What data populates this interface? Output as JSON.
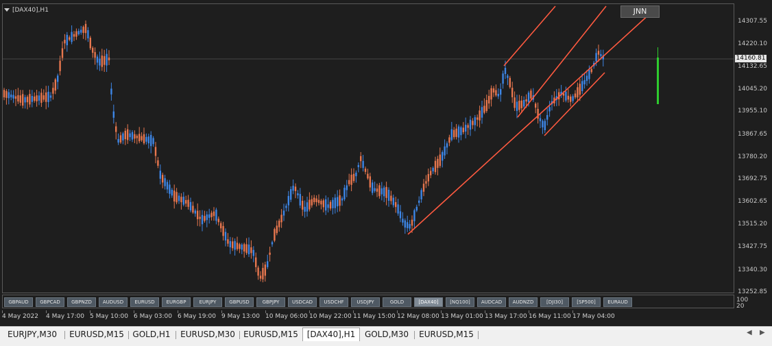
{
  "chart": {
    "title": "[DAX40],H1",
    "badge": "JNN",
    "current_price": "14160.81"
  },
  "price_axis": {
    "labels": [
      "14307.55",
      "14220.10",
      "14132.65",
      "14045.20",
      "13955.10",
      "13867.65",
      "13780.20",
      "13692.75",
      "13602.65",
      "13515.20",
      "13427.75",
      "13340.30",
      "13252.85"
    ]
  },
  "indicator_scale": {
    "top": "100",
    "bottom": "20"
  },
  "time_axis": {
    "labels": [
      "4 May 2022",
      "4 May 17:00",
      "5 May 10:00",
      "6 May 03:00",
      "6 May 19:00",
      "9 May 13:00",
      "10 May 06:00",
      "10 May 22:00",
      "11 May 15:00",
      "12 May 08:00",
      "13 May 01:00",
      "13 May 17:00",
      "16 May 11:00",
      "17 May 04:00"
    ]
  },
  "symbol_buttons": [
    {
      "label": "GBPAUD",
      "active": false
    },
    {
      "label": "GBPCAD",
      "active": false
    },
    {
      "label": "GBPNZD",
      "active": false
    },
    {
      "label": "AUDUSD",
      "active": false
    },
    {
      "label": "EURUSD",
      "active": false
    },
    {
      "label": "EURGBP",
      "active": false
    },
    {
      "label": "EURJPY",
      "active": false
    },
    {
      "label": "GBPUSD",
      "active": false
    },
    {
      "label": "GBPJPY",
      "active": false
    },
    {
      "label": "USDCAD",
      "active": false
    },
    {
      "label": "USDCHF",
      "active": false
    },
    {
      "label": "USDJPY",
      "active": false
    },
    {
      "label": "GOLD",
      "active": false
    },
    {
      "label": "[DAX40]",
      "active": true
    },
    {
      "label": "[NQ100]",
      "active": false
    },
    {
      "label": "AUDCAD",
      "active": false
    },
    {
      "label": "AUDNZD",
      "active": false
    },
    {
      "label": "[DJI30]",
      "active": false
    },
    {
      "label": "[SP500]",
      "active": false
    },
    {
      "label": "EURAUD",
      "active": false
    }
  ],
  "tabs": [
    {
      "label": "EURJPY,M30",
      "active": false
    },
    {
      "label": "EURUSD,M15",
      "active": false
    },
    {
      "label": "GOLD,H1",
      "active": false
    },
    {
      "label": "EURUSD,M30",
      "active": false
    },
    {
      "label": "EURUSD,M15",
      "active": false
    },
    {
      "label": "[DAX40],H1",
      "active": true
    },
    {
      "label": "GOLD,M30",
      "active": false
    },
    {
      "label": "EURUSD,M15",
      "active": false
    }
  ],
  "colors": {
    "bull_candle": "#3d86e6",
    "bear_candle": "#e8774f",
    "channel_line": "#ff5a40",
    "volume_bar": "#2ecc2e"
  },
  "icons": {
    "title_caret": "triangle-down-icon",
    "scroll_left": "arrow-left-icon",
    "scroll_right": "arrow-right-icon"
  }
}
